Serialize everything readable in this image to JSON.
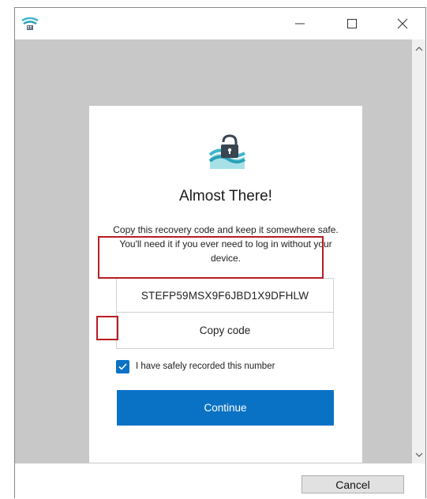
{
  "window": {
    "controls": {
      "minimize_icon": "minimize-icon",
      "maximize_icon": "maximize-icon",
      "close_icon": "close-icon"
    }
  },
  "dialog": {
    "title": "Almost There!",
    "description": "Copy this recovery code and keep it somewhere safe. You'll need it if you ever need to log in without your device.",
    "recovery_code": "STEFP59MSX9F6JBD1X9DFHLW",
    "copy_button_label": "Copy code",
    "checkbox_label": "I have safely recorded this number",
    "checkbox_checked": true,
    "continue_button_label": "Continue"
  },
  "footer": {
    "cancel_label": "Cancel"
  },
  "colors": {
    "accent": "#0a72c5",
    "highlight": "#b81c22",
    "background": "#c8c8c8"
  }
}
